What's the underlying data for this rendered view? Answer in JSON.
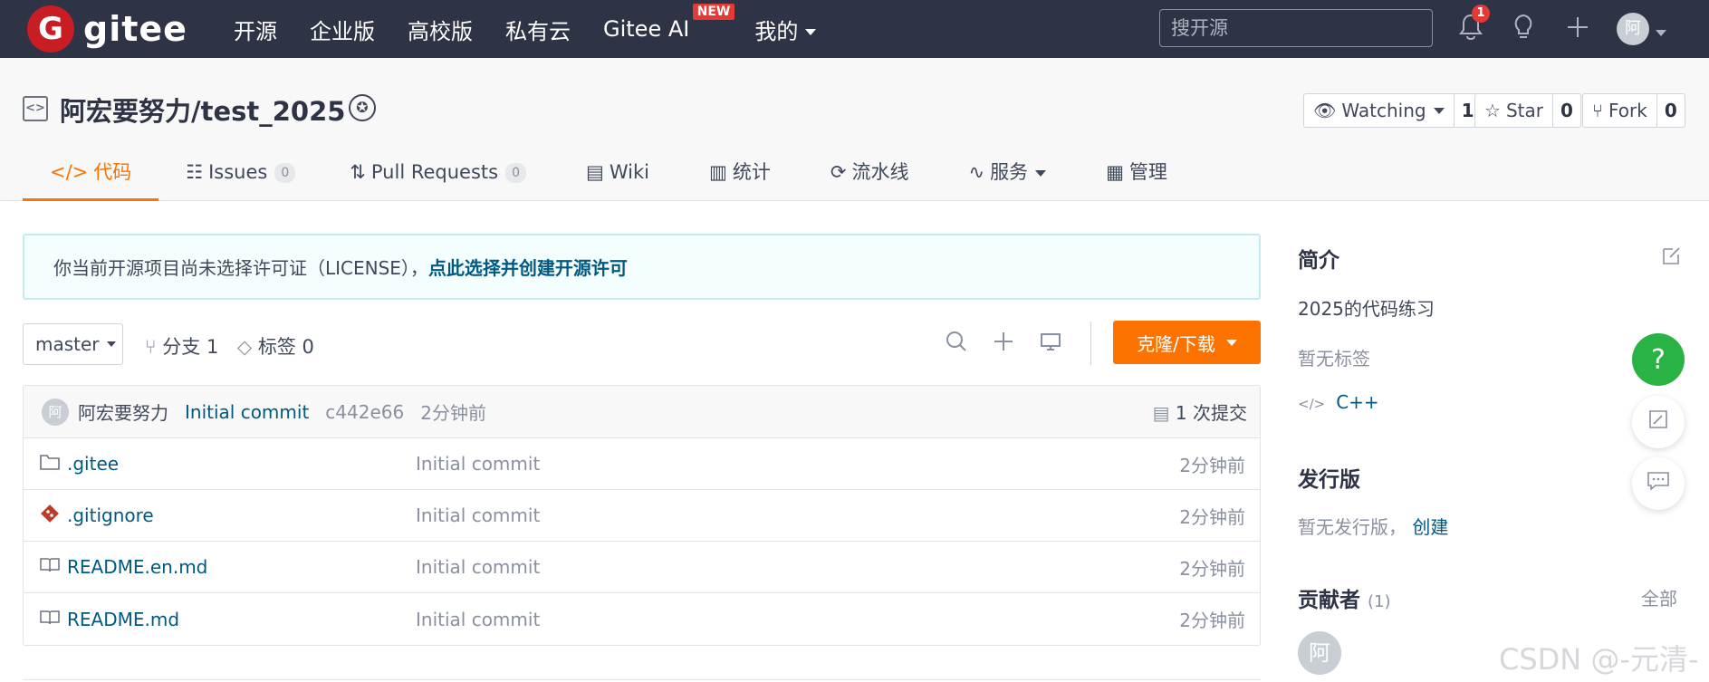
{
  "topbar": {
    "logo_letter": "G",
    "logo_text": "gitee",
    "nav": [
      "开源",
      "企业版",
      "高校版",
      "私有云",
      "Gitee AI",
      "我的"
    ],
    "new_badge": "NEW",
    "search_placeholder": "搜开源",
    "notif_count": "1",
    "avatar": "阿"
  },
  "repo": {
    "title": "阿宏要努力/test_2025",
    "watching_label": "Watching",
    "watching_count": "1",
    "star_label": "Star",
    "star_count": "0",
    "fork_label": "Fork",
    "fork_count": "0",
    "tabs": [
      {
        "label": "代码",
        "count": ""
      },
      {
        "label": "Issues",
        "count": "0"
      },
      {
        "label": "Pull Requests",
        "count": "0"
      },
      {
        "label": "Wiki",
        "count": ""
      },
      {
        "label": "统计",
        "count": ""
      },
      {
        "label": "流水线",
        "count": ""
      },
      {
        "label": "服务",
        "count": ""
      },
      {
        "label": "管理",
        "count": ""
      }
    ]
  },
  "license": {
    "text": "你当前开源项目尚未选择许可证（LICENSE），",
    "link": "点此选择并创建开源许可"
  },
  "toolbar": {
    "branch": "master",
    "branches": "分支 1",
    "tags": "标签 0",
    "clone": "克隆/下载"
  },
  "commit": {
    "avatar": "阿",
    "author": "阿宏要努力",
    "message": "Initial commit",
    "hash": "c442e66",
    "time": "2分钟前",
    "count": "1 次提交"
  },
  "files": [
    {
      "name": ".gitee",
      "message": "Initial commit",
      "time": "2分钟前",
      "icon": "folder-icon"
    },
    {
      "name": ".gitignore",
      "message": "Initial commit",
      "time": "2分钟前",
      "icon": "git-icon"
    },
    {
      "name": "README.en.md",
      "message": "Initial commit",
      "time": "2分钟前",
      "icon": "book-icon"
    },
    {
      "name": "README.md",
      "message": "Initial commit",
      "time": "2分钟前",
      "icon": "book-icon"
    }
  ],
  "sidebar": {
    "intro_title": "简介",
    "intro_text": "2025的代码练习",
    "no_tags": "暂无标签",
    "language": "C++",
    "release_title": "发行版",
    "no_release": "暂无发行版，",
    "create": "创建",
    "contributors_title": "贡献者",
    "contributors_count": "(1)",
    "all": "全部",
    "contributor_avatar": "阿"
  },
  "float": {
    "help": "?"
  },
  "watermark": "CSDN @-元清-",
  "colors": {
    "accent": "#fe7300",
    "link": "#005980",
    "topbar": "#2e3445",
    "help": "#29b345"
  }
}
